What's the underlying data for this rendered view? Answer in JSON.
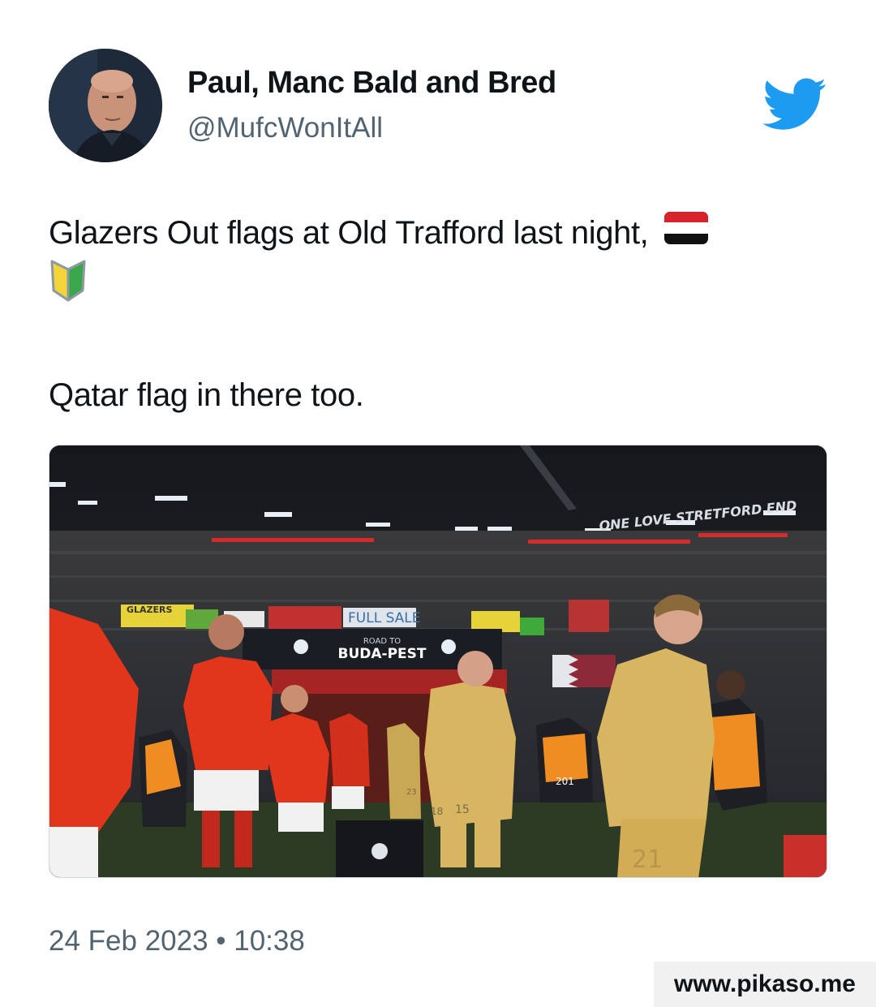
{
  "author": {
    "display_name": "Paul, Manc Bald and Bred",
    "handle": "@MufcWonItAll",
    "avatar_icon": "profile-photo"
  },
  "tweet": {
    "line1": "Glazers Out flags at Old Trafford last night,",
    "line1_emoji": "yemen-flag-emoji",
    "line2_emoji": "japanese-beginner-symbol-emoji",
    "line3": "Qatar flag in there too."
  },
  "media": {
    "banner_top": "ONE LOVE   STRETFORD END",
    "tunnel_small": "ROAD TO",
    "tunnel_big": "BUDA-PEST",
    "flag_full_sale": "FULL SALE",
    "flag_glazers": "GLAZERS",
    "steward_number": "201",
    "player_numbers": [
      "23",
      "15",
      "18",
      "21"
    ]
  },
  "timestamp": "24 Feb 2023 • 10:38",
  "watermark": "www.pikaso.me",
  "colors": {
    "twitter_blue": "#1d9bf0",
    "secondary_text": "#536471",
    "primary_text": "#0f1419",
    "united_red": "#e1361c",
    "barca_gold": "#d8b560"
  }
}
